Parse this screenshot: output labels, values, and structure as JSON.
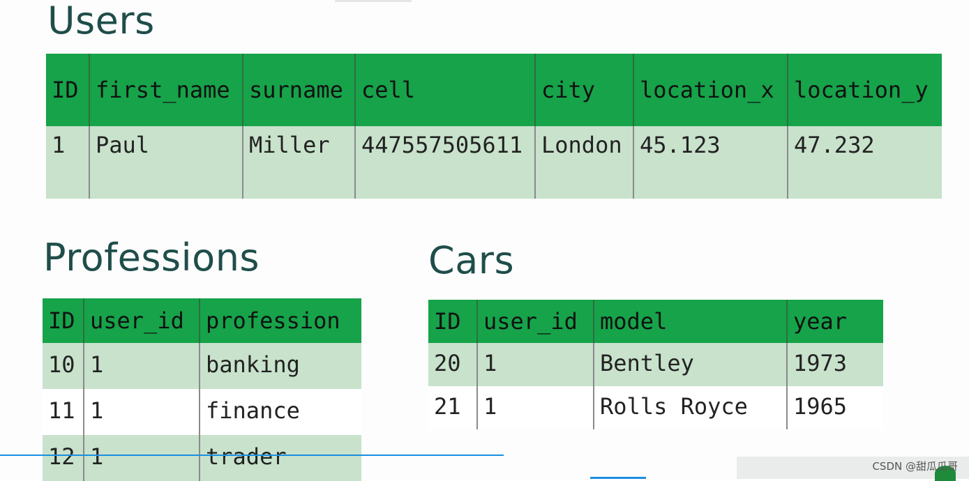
{
  "users": {
    "title": "Users",
    "columns": [
      "ID",
      "first_name",
      "surname",
      "cell",
      "city",
      "location_x",
      "location_y"
    ],
    "rows": [
      [
        "1",
        "Paul",
        "Miller",
        "447557505611",
        "London",
        "45.123",
        "47.232"
      ]
    ]
  },
  "professions": {
    "title": "Professions",
    "columns": [
      "ID",
      "user_id",
      "profession"
    ],
    "rows": [
      [
        "10",
        "1",
        "banking"
      ],
      [
        "11",
        "1",
        "finance"
      ],
      [
        "12",
        "1",
        "trader"
      ]
    ]
  },
  "cars": {
    "title": "Cars",
    "columns": [
      "ID",
      "user_id",
      "model",
      "year"
    ],
    "rows": [
      [
        "20",
        "1",
        "Bentley",
        "1973"
      ],
      [
        "21",
        "1",
        "Rolls Royce",
        "1965"
      ]
    ]
  },
  "watermark": "CSDN @甜瓜瓜哥",
  "colors": {
    "header_green": "#16a34a",
    "row_light_green": "#c8e2cc",
    "title_teal": "#1f4e4a"
  }
}
